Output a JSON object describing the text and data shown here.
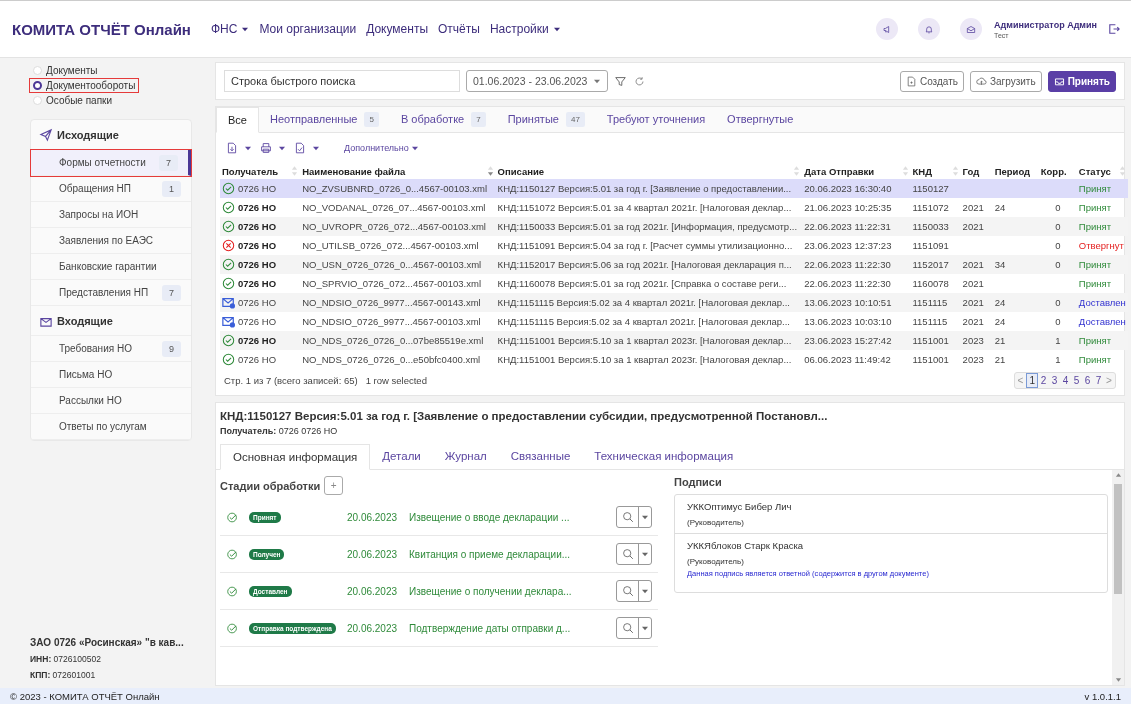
{
  "header": {
    "title": "КОМИТА ОТЧЁТ Онлайн",
    "nav": [
      {
        "label": "ФНС",
        "dropdown": true
      },
      {
        "label": "Мои организации",
        "dropdown": false
      },
      {
        "label": "Документы",
        "dropdown": false
      },
      {
        "label": "Отчёты",
        "dropdown": false
      },
      {
        "label": "Настройки",
        "dropdown": true
      }
    ],
    "user": {
      "name": "Администратор Админ",
      "role": "Тест"
    }
  },
  "sidebar": {
    "modes": [
      {
        "label": "Документы",
        "selected": false,
        "highlighted": false
      },
      {
        "label": "Документообороты",
        "selected": true,
        "highlighted": true
      },
      {
        "label": "Особые папки",
        "selected": false,
        "highlighted": false
      }
    ],
    "groups": [
      {
        "title": "Исходящие",
        "kind": "outgoing",
        "items": [
          {
            "label": "Формы отчетности",
            "count": "7",
            "selected": true,
            "highlighted": true
          },
          {
            "label": "Обращения НП",
            "count": "1",
            "selected": false,
            "highlighted": false
          },
          {
            "label": "Запросы на ИОН",
            "selected": false,
            "highlighted": false
          },
          {
            "label": "Заявления по ЕАЭС",
            "selected": false,
            "highlighted": false
          },
          {
            "label": "Банковские гарантии",
            "selected": false,
            "highlighted": false
          },
          {
            "label": "Представления НП",
            "count": "7",
            "selected": false,
            "highlighted": false
          }
        ]
      },
      {
        "title": "Входящие",
        "kind": "incoming",
        "items": [
          {
            "label": "Требования НО",
            "count": "9",
            "selected": false,
            "highlighted": false
          },
          {
            "label": "Письма НО",
            "selected": false,
            "highlighted": false
          },
          {
            "label": "Рассылки НО",
            "selected": false,
            "highlighted": false
          },
          {
            "label": "Ответы по услугам",
            "selected": false,
            "highlighted": false
          }
        ]
      }
    ],
    "organization": {
      "name": "ЗАО 0726 «Росинская» \"в кав...",
      "details": [
        "**ИНН:** 0726100502",
        "**КПП:** 072601001"
      ]
    }
  },
  "toolbar": {
    "search": {
      "placeholder": "Строка быстрого поиска"
    },
    "date_range": "01.06.2023 - 23.06.2023",
    "buttons": [
      {
        "label": "Создать",
        "kind": "create"
      },
      {
        "label": "Загрузить",
        "kind": "upload"
      },
      {
        "label": "Принять",
        "kind": "accept"
      }
    ]
  },
  "tabs": [
    {
      "label": "Все",
      "selected": true
    },
    {
      "label": "Неотправленные",
      "count": "5",
      "selected": false
    },
    {
      "label": "В обработке",
      "count": "7",
      "selected": false
    },
    {
      "label": "Принятые",
      "count": "47",
      "selected": false
    },
    {
      "label": "Требуют уточнения",
      "selected": false
    },
    {
      "label": "Отвергнутые",
      "selected": false
    }
  ],
  "actions": {
    "more": "Дополнительно"
  },
  "table": {
    "columns": [
      {
        "label": "Получатель",
        "sortable": true,
        "sorted_desc": false
      },
      {
        "label": "Наименование файла",
        "sortable": true,
        "sorted_desc": true
      },
      {
        "label": "Описание",
        "sortable": true,
        "sorted_desc": false
      },
      {
        "label": "Дата Отправки",
        "sortable": true,
        "sorted_desc": false
      },
      {
        "label": "КНД",
        "sortable": true,
        "sorted_desc": false
      },
      {
        "label": "Год",
        "sortable": false
      },
      {
        "label": "Период",
        "sortable": false
      },
      {
        "label": "Корр.",
        "sortable": false
      },
      {
        "label": "Статус",
        "sortable": true,
        "sorted_desc": false
      }
    ],
    "rows": [
      {
        "kind": "ok",
        "selected": true,
        "unread": false,
        "recipient": "0726 НО",
        "file": "NO_ZVSUBNRD_0726_0...4567-00103.xml",
        "description": "КНД:1150127 Версия:5.01 за год г. [Заявление о предоставлении...",
        "date": "20.06.2023 16:30:40",
        "knd": "1150127",
        "status": "Принят"
      },
      {
        "kind": "ok",
        "selected": false,
        "unread": true,
        "recipient": "0726 НО",
        "file": "NO_VODANAL_0726_07...4567-00103.xml",
        "description": "КНД:1151072 Версия:5.01 за 4 квартал 2021г. [Налоговая деклар...",
        "date": "21.06.2023 10:25:35",
        "knd": "1151072",
        "year": "2021",
        "period": "24",
        "corr": "0",
        "status": "Принят"
      },
      {
        "kind": "ok",
        "selected": false,
        "unread": true,
        "recipient": "0726 НО",
        "file": "NO_UVROPR_0726_072...4567-00103.xml",
        "description": "КНД:1150033 Версия:5.01 за год 2021г. [Информация, предусмотр...",
        "date": "22.06.2023 11:22:31",
        "knd": "1150033",
        "year": "2021",
        "corr": "0",
        "status": "Принят"
      },
      {
        "kind": "error",
        "selected": false,
        "unread": true,
        "recipient": "0726 НО",
        "file": "NO_UTILSB_0726_072...4567-00103.xml",
        "description": "КНД:1151091 Версия:5.04 за год г. [Расчет суммы утилизационно...",
        "date": "23.06.2023 12:37:23",
        "knd": "1151091",
        "corr": "0",
        "status": "Отвергнут"
      },
      {
        "kind": "ok",
        "selected": false,
        "unread": true,
        "recipient": "0726 НО",
        "file": "NO_USN_0726_0726_0...4567-00103.xml",
        "description": "КНД:1152017 Версия:5.06 за год 2021г. [Налоговая декларация п...",
        "date": "22.06.2023 11:22:30",
        "knd": "1152017",
        "year": "2021",
        "period": "34",
        "corr": "0",
        "status": "Принят"
      },
      {
        "kind": "ok",
        "selected": false,
        "unread": true,
        "recipient": "0726 НО",
        "file": "NO_SPRVIO_0726_072...4567-00103.xml",
        "description": "КНД:1160078 Версия:5.01 за год 2021г. [Справка о составе реги...",
        "date": "22.06.2023 11:22:30",
        "knd": "1160078",
        "year": "2021",
        "status": "Принят"
      },
      {
        "kind": "mail",
        "selected": false,
        "unread": false,
        "recipient": "0726 НО",
        "file": "NO_NDSIO_0726_9977...4567-00143.xml",
        "description": "КНД:1151115 Версия:5.02 за 4 квартал 2021г. [Налоговая деклар...",
        "date": "13.06.2023 10:10:51",
        "knd": "1151115",
        "year": "2021",
        "period": "24",
        "corr": "0",
        "status": "Доставлен"
      },
      {
        "kind": "mail",
        "selected": false,
        "unread": false,
        "recipient": "0726 НО",
        "file": "NO_NDSIO_0726_9977...4567-00103.xml",
        "description": "КНД:1151115 Версия:5.02 за 4 квартал 2021г. [Налоговая деклар...",
        "date": "13.06.2023 10:03:10",
        "knd": "1151115",
        "year": "2021",
        "period": "24",
        "corr": "0",
        "status": "Доставлен"
      },
      {
        "kind": "ok",
        "selected": false,
        "unread": true,
        "recipient": "0726 НО",
        "file": "NO_NDS_0726_0726_0...07be85519e.xml",
        "description": "КНД:1151001 Версия:5.10 за 1 квартал 2023г. [Налоговая деклар...",
        "date": "23.06.2023 15:27:42",
        "knd": "1151001",
        "year": "2023",
        "period": "21",
        "corr": "1",
        "status": "Принят"
      },
      {
        "kind": "ok",
        "selected": false,
        "unread": false,
        "recipient": "0726 НО",
        "file": "NO_NDS_0726_0726_0...e50bfc0400.xml",
        "description": "КНД:1151001 Версия:5.10 за 1 квартал 2023г. [Налоговая деклар...",
        "date": "06.06.2023 11:49:42",
        "knd": "1151001",
        "year": "2023",
        "period": "21",
        "corr": "1",
        "status": "Принят"
      }
    ]
  },
  "pager": {
    "summary": "Стр. 1 из 7 (всего записей: 65)",
    "selection": "1 row selected",
    "prev": "<",
    "next": ">",
    "pages": [
      {
        "label": "1",
        "selected": true
      },
      {
        "label": "2",
        "selected": false
      },
      {
        "label": "3",
        "selected": false
      },
      {
        "label": "4",
        "selected": false
      },
      {
        "label": "5",
        "selected": false
      },
      {
        "label": "6",
        "selected": false
      },
      {
        "label": "7",
        "selected": false
      }
    ]
  },
  "detail": {
    "title": "КНД:1150127 Версия:5.01 за год г. [Заявление о предоставлении субсидии, предусмотренной Постановл...",
    "recipient": "**Получатель:** 0726 0726 НО",
    "tabs": [
      {
        "label": "Основная информация",
        "selected": true
      },
      {
        "label": "Детали",
        "selected": false
      },
      {
        "label": "Журнал",
        "selected": false
      },
      {
        "label": "Связанные",
        "selected": false
      },
      {
        "label": "Техническая информация",
        "selected": false
      }
    ],
    "stages_title": "Стадии обработки",
    "add_label": "+",
    "stages": [
      {
        "badge": "Принят",
        "date": "20.06.2023",
        "text": "Извещение о вводе декларации ..."
      },
      {
        "badge": "Получен",
        "date": "20.06.2023",
        "text": "Квитанция о приеме декларации..."
      },
      {
        "badge": "Доставлен",
        "date": "20.06.2023",
        "text": "Извещение о получении деклара..."
      },
      {
        "badge": "Отправка подтверждена",
        "date": "20.06.2023",
        "text": "Подтверждение даты отправки д..."
      }
    ],
    "signatures_title": "Подписи",
    "signatures": [
      {
        "name": "УККОптимус Бибер Лич",
        "role": "(Руководитель)"
      },
      {
        "name": "УККЯблоков Старк Краска",
        "role": "(Руководитель)",
        "note": "Данная подпись является ответной (содержится в другом документе)"
      }
    ]
  },
  "footer": {
    "copyright": "© 2023 - КОМИТА ОТЧЁТ Онлайн",
    "version": "v 1.0.1.1"
  }
}
